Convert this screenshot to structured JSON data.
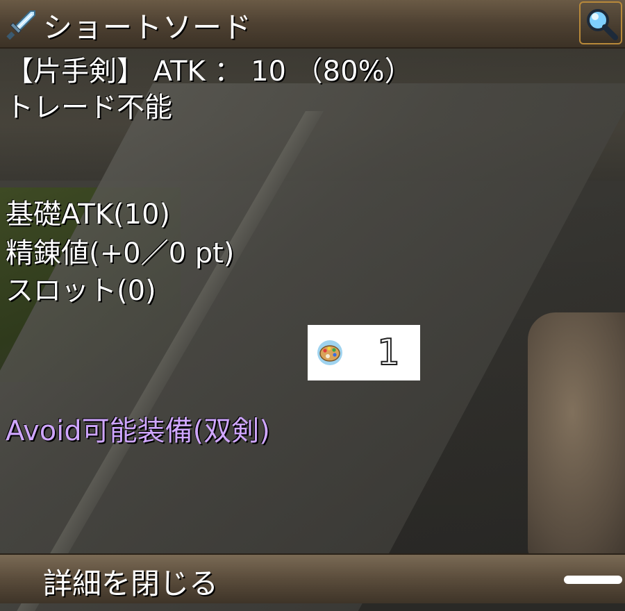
{
  "item": {
    "name": "ショートソード",
    "type_line": "【片手剣】 ATK ： 10 （80%）",
    "trade_line": "トレード不能",
    "base_atk_line": "基礎ATK(10)",
    "refine_line": "精錬値(+0／0 pt)",
    "slot_line": "スロット(0)",
    "special_line": "Avoid可能装備(双剣)"
  },
  "card_count": {
    "icon": "palette-icon",
    "value": "1"
  },
  "footer": {
    "close_label": "詳細を閉じる"
  },
  "icons": {
    "title_icon": "sword-icon",
    "search": "magnifier-icon"
  },
  "colors": {
    "special_text": "#cfa6ff",
    "frame_gold": "#b8893a"
  }
}
